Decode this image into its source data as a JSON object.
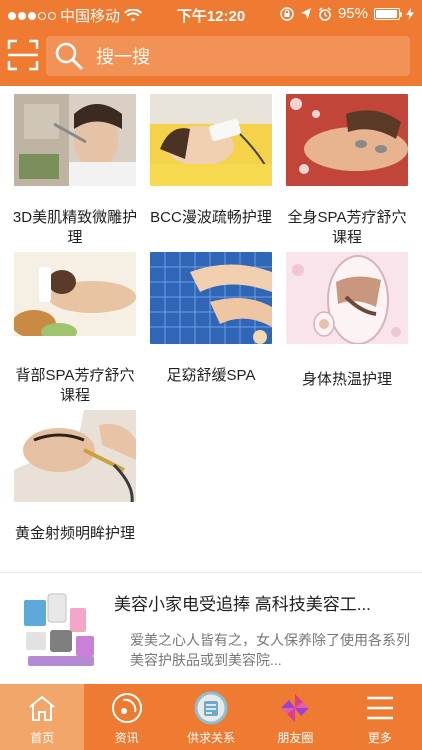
{
  "status_bar": {
    "carrier": "中国移动",
    "time": "下午12:20",
    "battery": "95%",
    "battery_level": 0.95
  },
  "header": {
    "search_placeholder": "搜一搜",
    "scan_icon": "scan-icon",
    "search_icon": "search-icon"
  },
  "grid": {
    "items": [
      {
        "label": "3D美肌精致微雕护理"
      },
      {
        "label": "BCC漫波疏畅护理"
      },
      {
        "label": "全身SPA芳疗舒穴课程"
      },
      {
        "label": "背部SPA芳疗舒穴课程"
      },
      {
        "label": "足窈舒缓SPA"
      },
      {
        "label": "身体热温护理"
      },
      {
        "label": "黄金射频明眸护理"
      }
    ]
  },
  "ad": {
    "title": "美容小家电受追捧 高科技美容工...",
    "desc": "爱美之心人皆有之，女人保养除了使用各系列美容护肤品或到美容院..."
  },
  "nav": {
    "items": [
      {
        "label": "首页",
        "icon": "home-icon",
        "active": true
      },
      {
        "label": "资讯",
        "icon": "news-icon"
      },
      {
        "label": "供求关系",
        "icon": "supply-demand-icon"
      },
      {
        "label": "朋友圈",
        "icon": "moments-icon"
      },
      {
        "label": "更多",
        "icon": "menu-icon"
      }
    ]
  },
  "colors": {
    "brand_orange": "#ef7a31",
    "active_tab": "#f3a66a"
  }
}
